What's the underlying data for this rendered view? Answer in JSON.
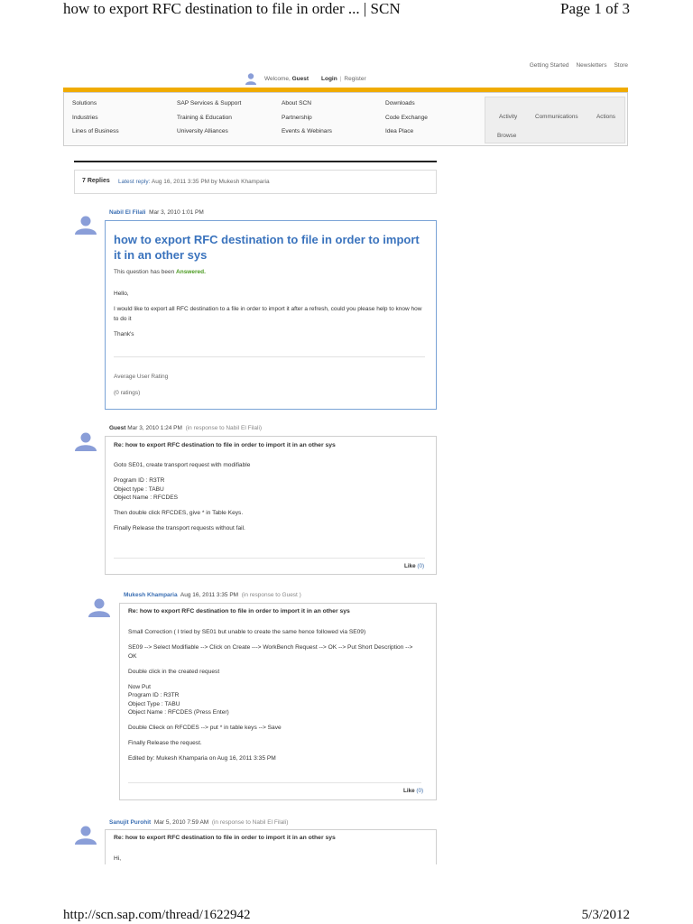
{
  "print": {
    "title": "how to export RFC destination to file in order ... | SCN",
    "page": "Page 1 of 3",
    "url": "http://scn.sap.com/thread/1622942",
    "date": "5/3/2012"
  },
  "util_links": [
    "Getting Started",
    "Newsletters",
    "Store"
  ],
  "welcome": {
    "prefix": "Welcome,",
    "user": "Guest",
    "login": "Login",
    "sep": "|",
    "register": "Register"
  },
  "nav": {
    "col1": [
      "Solutions",
      "Industries",
      "Lines of Business"
    ],
    "col2": [
      "SAP Services & Support",
      "Training & Education",
      "University Alliances"
    ],
    "col3": [
      "About SCN",
      "Partnership",
      "Events & Webinars"
    ],
    "col4": [
      "Downloads",
      "Code Exchange",
      "Idea Place"
    ],
    "activity": "Activity",
    "communications": "Communications",
    "actions": "Actions",
    "browse": "Browse"
  },
  "replies": {
    "count": "7 Replies",
    "latest_label": "Latest reply:",
    "latest_value": "Aug 16, 2011 3:35 PM by Mukesh Khamparia"
  },
  "question": {
    "author": "Nabil El Filali",
    "date": "Mar 3, 2010 1:01 PM",
    "title": "how to export RFC destination to file in order to import it in an other sys",
    "status_prefix": "This question has been",
    "status": "Answered.",
    "body": [
      "Hello,",
      "I would like to export all RFC destination to a file in order to import it after a refresh, could you please help to know how to do it",
      "Thank's"
    ],
    "rating_label": "Average User Rating",
    "ratings_count": "(0 ratings)"
  },
  "reply1": {
    "author": "Guest",
    "date": "Mar 3, 2010 1:24 PM",
    "context": "(in response to Nabil El Filali)",
    "title": "Re: how to export RFC destination to file in order to import it in an other sys",
    "body": [
      "Goto SE01, create transport request with modifiable",
      "Program ID : R3TR\nObject type : TABU\nObject Name : RFCDES",
      "Then double click RFCDES, give * in Table Keys.",
      "Finally Release the transport requests without fail."
    ],
    "like": "Like",
    "like_count": "(0)"
  },
  "reply2": {
    "author": "Mukesh Khamparia",
    "date": "Aug 16, 2011 3:35 PM",
    "context": "(in response to Guest )",
    "title": "Re: how to export RFC destination to file in order to import it in an other sys",
    "body": [
      "Small Correction ( I tried by SE01 but unable to create the same hence followed via SE09)",
      "SE09 --> Select Modifiable --> Click on Create ---> WorkBench Request --> OK --> Put Short Description --> OK",
      "Double click in the created request",
      "Now Put\nProgram ID : R3TR\nObject Type : TABU\nObject Name : RFCDES (Press Enter)",
      "Double Clieck on RFCDES --> put * in table keys  --> Save",
      "Finally Release the request.",
      "Edited by: Mukesh Khamparia on Aug 16, 2011 3:35 PM"
    ],
    "like": "Like",
    "like_count": "(0)"
  },
  "reply3": {
    "author": "Sanujit Purohit",
    "date": "Mar 5, 2010 7:59 AM",
    "context": "(in response to Nabil El Filali)",
    "title": "Re: how to export RFC destination to file in order to import it in an other sys",
    "body": [
      "Hi,"
    ]
  }
}
